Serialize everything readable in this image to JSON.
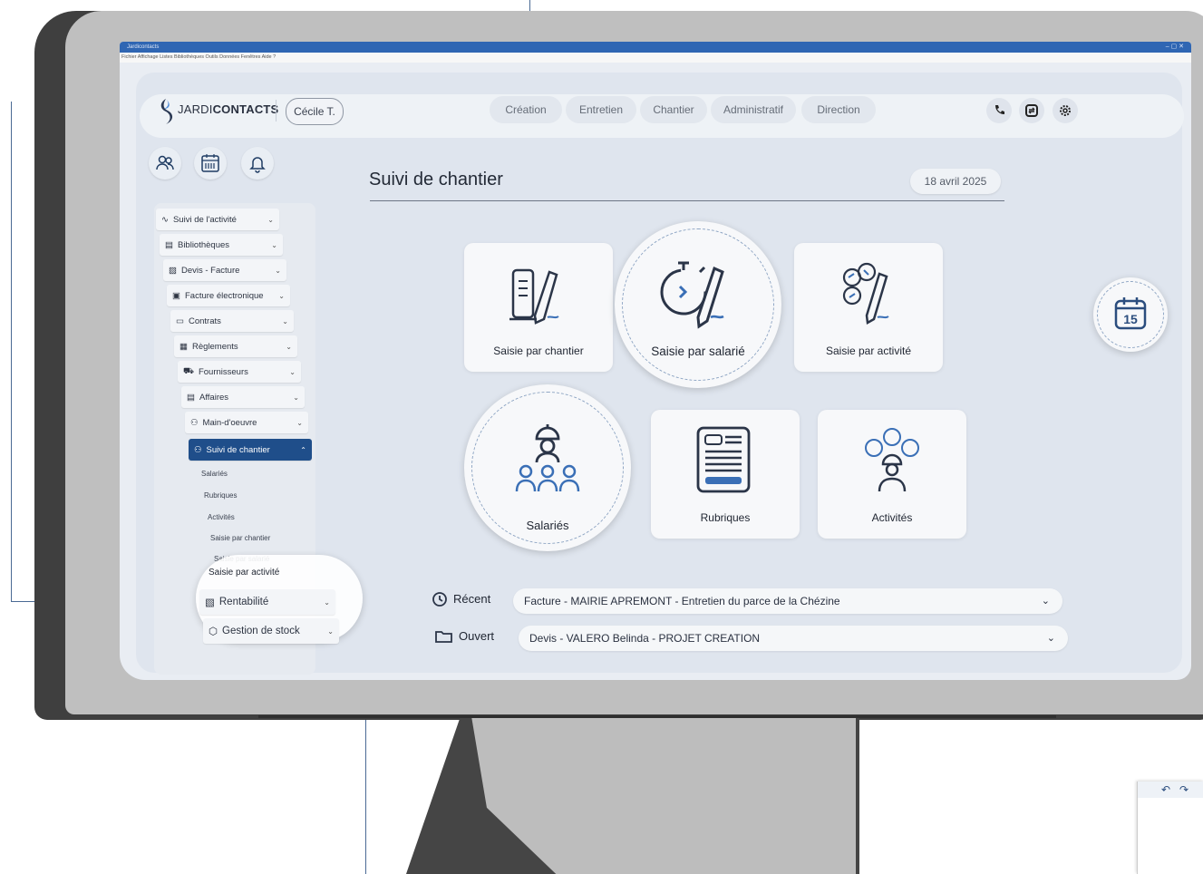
{
  "window": {
    "title": "Jardicontacts",
    "controls": "‒ ▢ ✕",
    "menu": "Fichier  Affichage  Listes  Bibliothèques  Outils  Données  Fenêtres  Aide  ?"
  },
  "header": {
    "brand_prefix": "JARDI",
    "brand_bold": "CONTACTS",
    "user": "Cécile T.",
    "tabs": [
      "Création",
      "Entretien",
      "Chantier",
      "Administratif",
      "Direction"
    ]
  },
  "sidebar": {
    "items": [
      {
        "label": "Suivi de l'activité",
        "icon": "activity-icon"
      },
      {
        "label": "Bibliothèques",
        "icon": "library-icon"
      },
      {
        "label": "Devis - Facture",
        "icon": "quote-icon"
      },
      {
        "label": "Facture électronique",
        "icon": "invoice-icon"
      },
      {
        "label": "Contrats",
        "icon": "contract-icon"
      },
      {
        "label": "Règlements",
        "icon": "payment-icon"
      },
      {
        "label": "Fournisseurs",
        "icon": "truck-icon"
      },
      {
        "label": "Affaires",
        "icon": "folder-icon"
      },
      {
        "label": "Main-d'oeuvre",
        "icon": "workforce-icon"
      },
      {
        "label": "Suivi de chantier",
        "icon": "worker-icon"
      }
    ],
    "subitems": [
      "Salariés",
      "Rubriques",
      "Activités",
      "Saisie par chantier",
      "Saisie par salarié"
    ],
    "zoom_items": {
      "sub": "Saisie par activité",
      "rentabilite": "Rentabilité",
      "stock": "Gestion de stock"
    }
  },
  "main": {
    "title": "Suivi de chantier",
    "date": "18 avril 2025",
    "cards": {
      "chantier": "Saisie par chantier",
      "salarie": "Saisie par salarié",
      "activite": "Saisie par activité",
      "salaries": "Salariés",
      "rubriques": "Rubriques",
      "activites": "Activités"
    },
    "calendar_day": "15",
    "recent": {
      "label": "Récent",
      "value": "Facture - MAIRIE APREMONT - Entretien du parce de la Chézine"
    },
    "open": {
      "label": "Ouvert",
      "value": "Devis - VALERO Belinda - PROJET CREATION"
    }
  },
  "colors": {
    "accent": "#1f4e8a",
    "callout": "#4a6a94"
  }
}
